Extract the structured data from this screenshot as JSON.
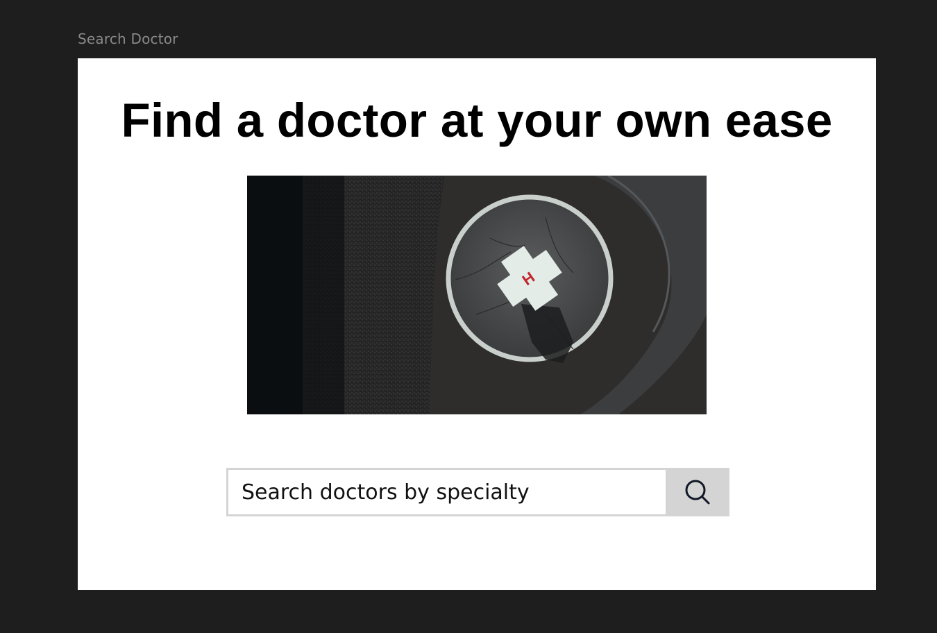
{
  "frame": {
    "label": "Search Doctor"
  },
  "hero": {
    "headline": "Find a doctor at your own ease",
    "image_subject": "aerial view of hospital helipad with H marker",
    "helipad_marker": "H"
  },
  "search": {
    "placeholder": "Search doctors by specialty",
    "value": "",
    "button_icon": "search-icon"
  },
  "colors": {
    "canvas_background": "#1e1e1e",
    "frame_background": "#ffffff",
    "headline": "#000000",
    "search_border": "#d4d4d4",
    "search_button_bg": "#d4d4d4",
    "helipad_marker": "#c0272d"
  }
}
